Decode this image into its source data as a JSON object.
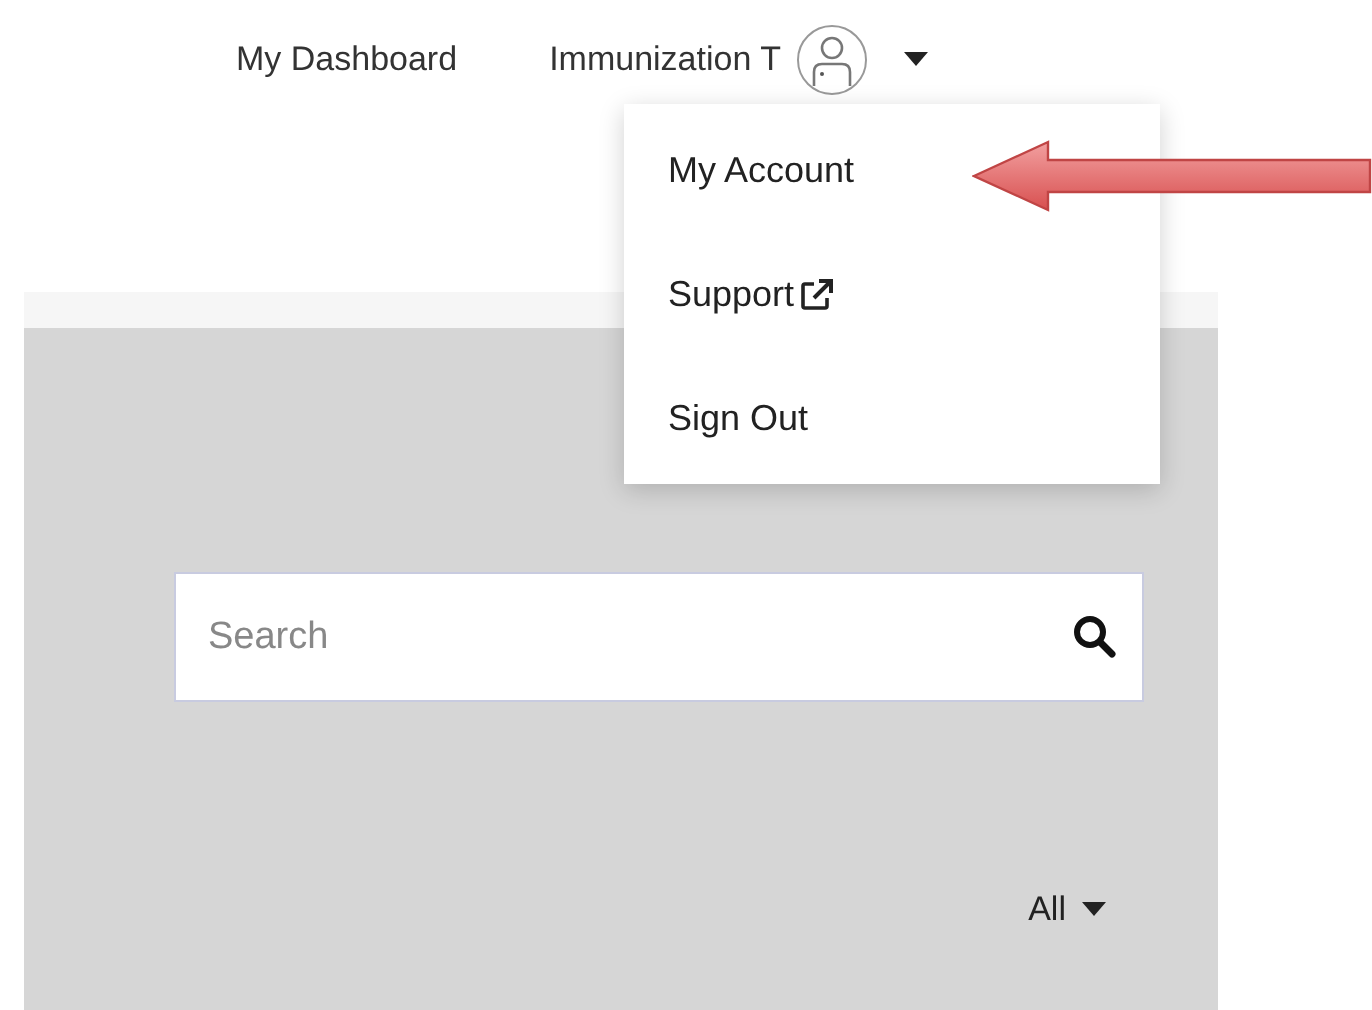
{
  "nav": {
    "dashboard_link": "My Dashboard",
    "user_name": "Immunization T"
  },
  "user_menu": {
    "expanded": true,
    "items": [
      {
        "label": "My Account",
        "external": false,
        "highlighted_by_arrow": true
      },
      {
        "label": "Support",
        "external": true,
        "highlighted_by_arrow": false
      },
      {
        "label": "Sign Out",
        "external": false,
        "highlighted_by_arrow": false
      }
    ]
  },
  "search": {
    "placeholder": "Search"
  },
  "filter": {
    "label": "All"
  }
}
